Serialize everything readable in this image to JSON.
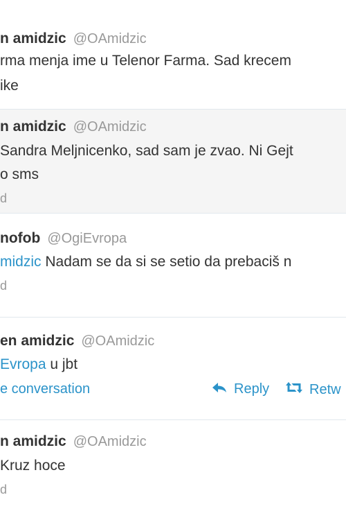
{
  "tweets": [
    {
      "name": "n amidzic",
      "handle": "@OAmidzic",
      "lines": [
        "rma menja ime u Telenor Farma. Sad krecem",
        "ike"
      ]
    },
    {
      "name": "n amidzic",
      "handle": "@OAmidzic",
      "lines": [
        "Sandra Meljnicenko, sad sam je zvao. Ni Gejt",
        "o sms"
      ],
      "time": "d"
    },
    {
      "name": "nofob",
      "handle": "@OgiEvropa",
      "mention": "midzic",
      "text": " Nadam se da si se setio da prebaciš n",
      "time": "d"
    },
    {
      "name": "en amidzic",
      "handle": "@OAmidzic",
      "mention": "Evropa",
      "text": " u jbt",
      "conversation": "e conversation",
      "reply": "Reply",
      "retweet": "Retw"
    },
    {
      "name": "n amidzic",
      "handle": "@OAmidzic",
      "text": "Kruz hoce",
      "time": "d"
    }
  ]
}
